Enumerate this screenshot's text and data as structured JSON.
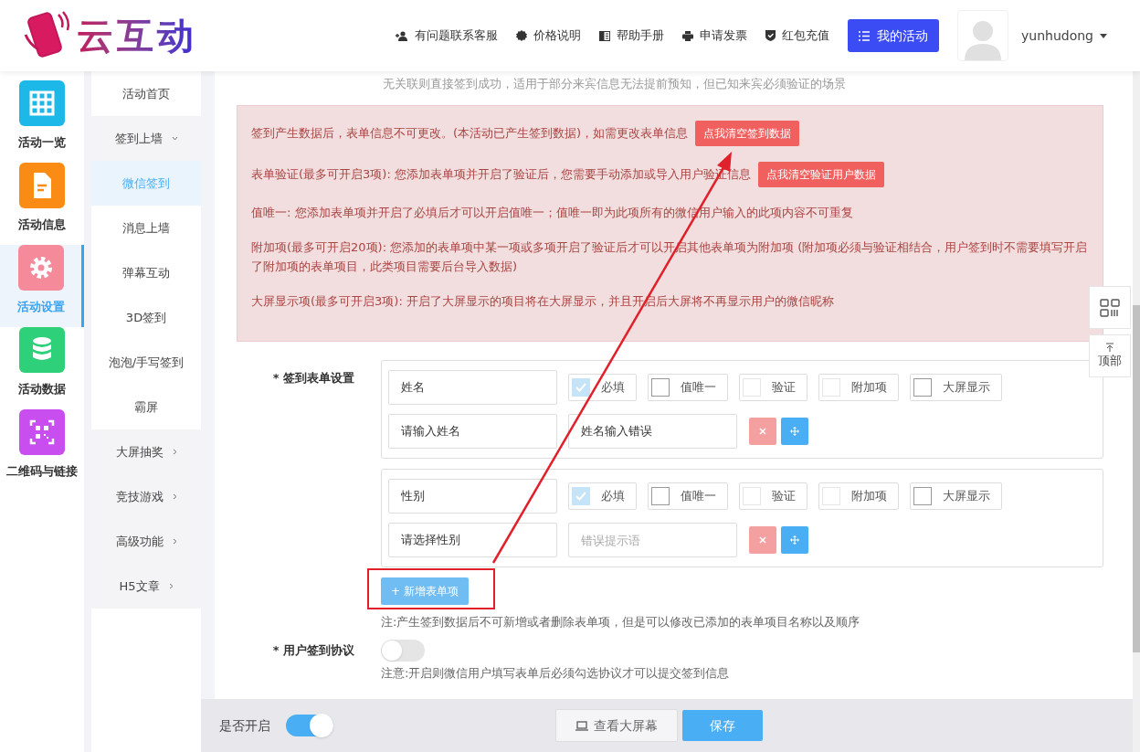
{
  "header": {
    "logo_text": "云互动",
    "nav": [
      {
        "label": "有问题联系客服",
        "kind": "user-plus"
      },
      {
        "label": "价格说明",
        "kind": "badge"
      },
      {
        "label": "帮助手册",
        "kind": "book"
      },
      {
        "label": "申请发票",
        "kind": "printer"
      },
      {
        "label": "红包充值",
        "kind": "shield"
      }
    ],
    "primary_button": "我的活动",
    "username": "yunhudong"
  },
  "sidebar": {
    "items": [
      {
        "label": "活动一览",
        "kind": "grid",
        "color": "#1cb8e8",
        "selected": false
      },
      {
        "label": "活动信息",
        "kind": "doc",
        "color": "#fa8c16",
        "selected": false
      },
      {
        "label": "活动设置",
        "kind": "gear",
        "color": "#f58a9b",
        "selected": true
      },
      {
        "label": "活动数据",
        "kind": "database",
        "color": "#2fd07a",
        "selected": false
      },
      {
        "label": "二维码与链接",
        "kind": "qr",
        "color": "#c94ef0",
        "selected": false
      }
    ]
  },
  "submenu": {
    "items": [
      {
        "label": "活动首页",
        "selected": false
      },
      {
        "label": "签到上墙",
        "expanded": true,
        "selected": false,
        "children": [
          {
            "label": "微信签到",
            "selected": true
          },
          {
            "label": "消息上墙",
            "selected": false
          },
          {
            "label": "弹幕互动",
            "selected": false
          },
          {
            "label": "3D签到",
            "selected": false
          },
          {
            "label": "泡泡/手写签到",
            "selected": false
          },
          {
            "label": "霸屏",
            "selected": false
          }
        ]
      },
      {
        "label": "大屏抽奖",
        "expanded": false,
        "selected": false
      },
      {
        "label": "竞技游戏",
        "expanded": false,
        "selected": false
      },
      {
        "label": "高级功能",
        "expanded": false,
        "selected": false
      },
      {
        "label": "H5文章",
        "expanded": false,
        "selected": false
      }
    ]
  },
  "main": {
    "top_note": "无关联则直接签到成功，适用于部分来宾信息无法提前预知，但已知来宾必须验证的场景",
    "alert": [
      {
        "text": "签到产生数据后，表单信息不可更改。(本活动已产生签到数据)，如需更改表单信息",
        "button": "点我清空签到数据"
      },
      {
        "text": "表单验证(最多可开启3项): 您添加表单项并开启了验证后，您需要手动添加或导入用户验证信息",
        "button": "点我清空验证用户数据"
      },
      {
        "text": "值唯一: 您添加表单项并开启了必填后才可以开启值唯一；值唯一即为此项所有的微信用户输入的此项内容不可重复"
      },
      {
        "text": "附加项(最多可开启20项): 您添加的表单项中某一项或多项开启了验证后才可以开启其他表单项为附加项 (附加项必须与验证相结合，用户签到时不需要填写开启了附加项的表单项目，此类项目需要后台导入数据)"
      },
      {
        "text": "大屏显示项(最多可开启3项): 开启了大屏显示的项目将在大屏显示，并且开启后大屏将不再显示用户的微信昵称"
      }
    ],
    "form_label": "* 签到表单设置",
    "form_items": [
      {
        "name": "姓名",
        "options": [
          {
            "label": "必填",
            "checked": true,
            "disabled": true
          },
          {
            "label": "值唯一",
            "checked": false,
            "disabled": false
          },
          {
            "label": "验证",
            "checked": false,
            "disabled": true
          },
          {
            "label": "附加项",
            "checked": false,
            "disabled": true
          },
          {
            "label": "大屏显示",
            "checked": false,
            "disabled": false
          }
        ],
        "prompt": "请输入姓名",
        "error_message": {
          "value": "姓名输入错误"
        }
      },
      {
        "name": "性别",
        "options": [
          {
            "label": "必填",
            "checked": true,
            "disabled": true
          },
          {
            "label": "值唯一",
            "checked": false,
            "disabled": false
          },
          {
            "label": "验证",
            "checked": false,
            "disabled": true
          },
          {
            "label": "附加项",
            "checked": false,
            "disabled": true
          },
          {
            "label": "大屏显示",
            "checked": false,
            "disabled": false
          }
        ],
        "prompt": "请选择性别",
        "error_message": {
          "placeholder": "错误提示语"
        }
      }
    ],
    "add_button": "+ 新增表单项",
    "form_note": "注:产生签到数据后不可新增或者删除表单项，但是可以修改已添加的表单项目名称以及顺序",
    "agreement_label": "* 用户签到协议",
    "agreement_on": false,
    "agreement_note": "注意:开启则微信用户填写表单后必须勾选协议才可以提交签到信息"
  },
  "float": {
    "top_button": "顶部"
  },
  "footer": {
    "enable_label": "是否开启",
    "enable_on": true,
    "view_button": "查看大屏幕",
    "save_button": "保存"
  }
}
